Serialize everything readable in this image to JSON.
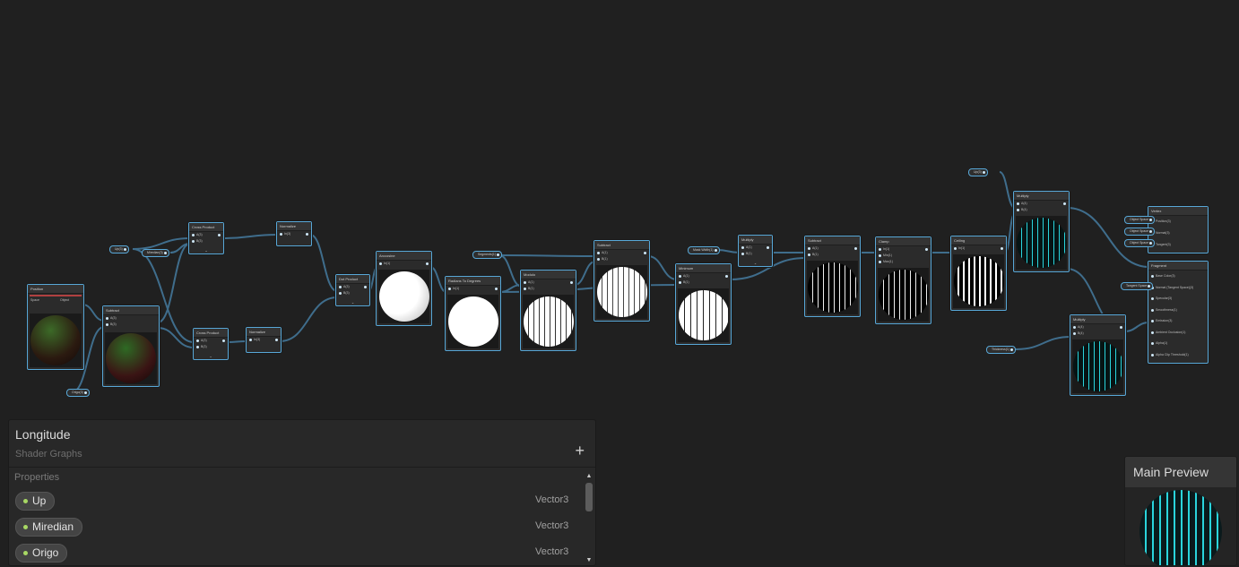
{
  "graph": {
    "properties_nodes": {
      "up1": "Up(3)",
      "up2": "Up(3)",
      "miredian": "Miredian(3)",
      "origo": "Origo(3)",
      "segments": "Segments(1)",
      "mask_width": "Mask Width(1)",
      "thickness": "Thickness(1)"
    },
    "nodes": {
      "position": {
        "title": "Position",
        "space_label": "Space",
        "space_value": "Object"
      },
      "subtract1": {
        "title": "Subtract",
        "a": "A(3)",
        "b": "B(3)",
        "out": "Out(3)"
      },
      "cross1": {
        "title": "Cross Product",
        "a": "A(3)",
        "b": "B(3)",
        "out": "Out(3)"
      },
      "cross2": {
        "title": "Cross Product",
        "a": "A(3)",
        "b": "B(3)",
        "out": "Out(3)"
      },
      "normalize1": {
        "title": "Normalize",
        "in": "In(3)",
        "out": "Out(3)"
      },
      "normalize2": {
        "title": "Normalize",
        "in": "In(3)",
        "out": "Out(3)"
      },
      "dot": {
        "title": "Dot Product",
        "a": "A(3)",
        "b": "B(3)",
        "out": "Out(1)"
      },
      "arccos": {
        "title": "Arccosine",
        "in": "In(1)",
        "out": "Out(1)"
      },
      "rad2deg": {
        "title": "Radians To Degrees",
        "in": "In(1)",
        "out": "Out(1)"
      },
      "modulo": {
        "title": "Modulo",
        "a": "A(1)",
        "b": "B(1)"
      },
      "subtract2": {
        "title": "Subtract",
        "a": "A(1)",
        "b": "B(1)",
        "out": "Out(1)"
      },
      "minimum": {
        "title": "Minimum",
        "a": "A(1)",
        "b": "B(1)"
      },
      "multiply1": {
        "title": "Multiply",
        "a": "A(1)",
        "b": "B(1)",
        "out": "Out(1)"
      },
      "subtract3": {
        "title": "Subtract",
        "a": "A(1)",
        "b": "B(1)",
        "out": "Out(1)"
      },
      "clamp": {
        "title": "Clamp",
        "in": "In(1)",
        "min": "Min(1)",
        "max": "Max(1)",
        "out": "Out(1)"
      },
      "ceiling": {
        "title": "Ceiling",
        "in": "In(1)",
        "out": "Out(1)"
      },
      "multiply2": {
        "title": "Multiply",
        "a": "A(4)",
        "b": "B(4)",
        "out": "Out(4)"
      },
      "multiply3": {
        "title": "Multiply",
        "a": "A(4)",
        "b": "B(4)",
        "out": "Out(4)"
      }
    },
    "vertex": {
      "title": "Vertex",
      "inputs": [
        "Position(3)",
        "Normal(3)",
        "Tangent(3)"
      ],
      "spaces": [
        "Object Space",
        "Object Space",
        "Object Space"
      ]
    },
    "fragment": {
      "title": "Fragment",
      "inputs": [
        "Base Color(3)",
        "Normal (Tangent Space)(3)",
        "Specular(3)",
        "Smoothness(1)",
        "Emission(3)",
        "Ambient Occlusion(1)",
        "Alpha(1)",
        "Alpha Clip Threshold(1)"
      ],
      "space": "Tangent Space"
    },
    "colors": {
      "accent": "#58a8d8",
      "cyan": "#2ad4dc",
      "wire": "#3f6d8c"
    }
  },
  "blackboard": {
    "title": "Longitude",
    "subtitle": "Shader Graphs",
    "add_label": "+",
    "section": "Properties",
    "properties": [
      {
        "name": "Up",
        "type": "Vector3"
      },
      {
        "name": "Miredian",
        "type": "Vector3"
      },
      {
        "name": "Origo",
        "type": "Vector3"
      }
    ]
  },
  "main_preview": {
    "title": "Main Preview"
  }
}
